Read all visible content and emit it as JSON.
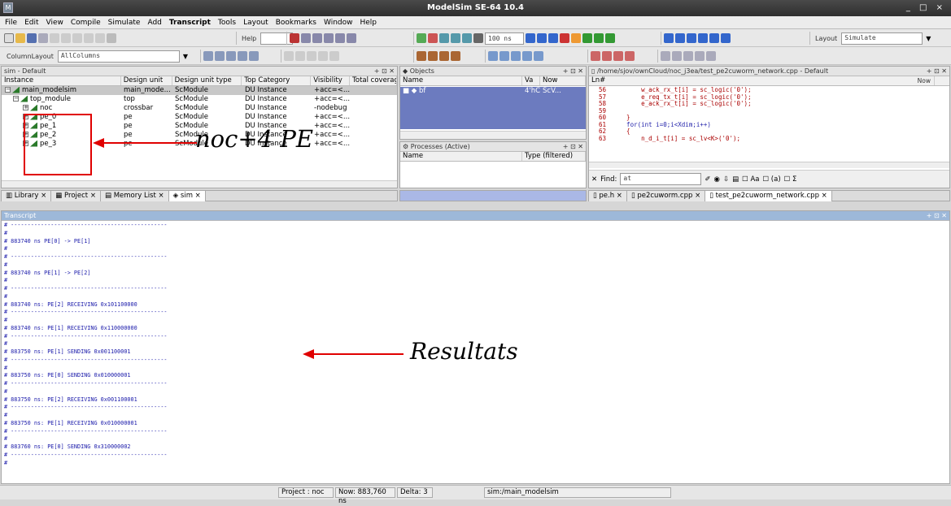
{
  "window": {
    "title": "ModelSim SE-64 10.4",
    "app_icon": "modelsim-icon",
    "controls": "_ □ ×"
  },
  "menu": [
    "File",
    "Edit",
    "View",
    "Compile",
    "Simulate",
    "Add",
    "Transcript",
    "Tools",
    "Layout",
    "Bookmarks",
    "Window",
    "Help"
  ],
  "toolbar": {
    "help_label": "Help",
    "time_value": "100 ns",
    "layout_label": "Layout",
    "layout_value": "Simulate",
    "column_layout_label": "ColumnLayout",
    "column_layout_value": "AllColumns"
  },
  "sim_panel": {
    "title": "sim - Default",
    "columns": [
      "Instance",
      "Design unit",
      "Design unit type",
      "Top Category",
      "Visibility",
      "Total coverag"
    ],
    "rows": [
      {
        "instance": "main_modelsim",
        "unit": "main_mode...",
        "type": "ScModule",
        "category": "DU Instance",
        "visibility": "+acc=<..."
      },
      {
        "instance": "top_module",
        "unit": "top",
        "type": "ScModule",
        "category": "DU Instance",
        "visibility": "+acc=<..."
      },
      {
        "instance": "noc",
        "unit": "crossbar",
        "type": "ScModule",
        "category": "DU Instance",
        "visibility": "-nodebug"
      },
      {
        "instance": "pe_0",
        "unit": "pe",
        "type": "ScModule",
        "category": "DU Instance",
        "visibility": "+acc=<..."
      },
      {
        "instance": "pe_1",
        "unit": "pe",
        "type": "ScModule",
        "category": "DU Instance",
        "visibility": "+acc=<..."
      },
      {
        "instance": "pe_2",
        "unit": "pe",
        "type": "ScModule",
        "category": "DU Instance",
        "visibility": "+acc=<..."
      },
      {
        "instance": "pe_3",
        "unit": "pe",
        "type": "ScModule",
        "category": "DU Instance",
        "visibility": "+acc=<..."
      }
    ],
    "tabs": [
      "Library",
      "Project",
      "Memory List",
      "sim"
    ]
  },
  "objects_panel": {
    "title": "Objects",
    "columns": [
      "Name",
      "Va",
      "Now"
    ],
    "rows": [
      {
        "name": "bf",
        "value": "4'hC",
        "extra": "ScV..."
      }
    ]
  },
  "processes_panel": {
    "title": "Processes (Active)",
    "columns": [
      "Name",
      "Type (filtered)"
    ]
  },
  "source_panel": {
    "title": "/home/sjov/ownCloud/noc_j3ea/test_pe2cuworm_network.cpp - Default",
    "ln_header": "Ln#",
    "now_label": "Now",
    "lines": [
      {
        "n": "56",
        "code": "        w_ack_rx_t[i] = sc_logic('0');"
      },
      {
        "n": "57",
        "code": "        e_req_tx_t[i] = sc_logic('0');"
      },
      {
        "n": "58",
        "code": "        e_ack_rx_t[i] = sc_logic('0');"
      },
      {
        "n": "59",
        "code": ""
      },
      {
        "n": "60",
        "code": "    }"
      },
      {
        "n": "61",
        "code": "    for(int i=0;i<Xdim;i++)"
      },
      {
        "n": "62",
        "code": "    {"
      },
      {
        "n": "63",
        "code": "        n_d_i_t[i] = sc_lv<K>('0');"
      }
    ],
    "find_label": "Find:",
    "find_value": "at",
    "find_opt_case": "Aa",
    "find_opt_word": "(a)",
    "find_opt_sum": "Σ",
    "tabs": [
      "pe.h",
      "pe2cuworm.cpp",
      "test_pe2cuworm_network.cpp"
    ]
  },
  "transcript": {
    "title": "Transcript",
    "lines": [
      "# -----------------------------------------------",
      "# ",
      "# 883740 ns PE[0] -> PE[1]",
      "# ",
      "# -----------------------------------------------",
      "# ",
      "# 883740 ns PE[1] -> PE[2]",
      "# ",
      "# -----------------------------------------------",
      "# ",
      "# 883740 ns: PE[2] RECEIVING 0x101100000",
      "# -----------------------------------------------",
      "# ",
      "# 883740 ns: PE[1] RECEIVING 0x110000000",
      "# -----------------------------------------------",
      "# ",
      "# 883750 ns: PE[1] SENDING 0x001100001",
      "# -----------------------------------------------",
      "# ",
      "# 883750 ns: PE[0] SENDING 0x010000001",
      "# -----------------------------------------------",
      "# ",
      "# 883750 ns: PE[2] RECEIVING 0x001100001",
      "# -----------------------------------------------",
      "# ",
      "# 883750 ns: PE[1] RECEIVING 0x010000001",
      "# -----------------------------------------------",
      "# ",
      "# 883760 ns: PE[0] SENDING 0x310000002",
      "# -----------------------------------------------",
      "# "
    ]
  },
  "status": {
    "project": "Project : noc",
    "now": "Now: 883,760 ns",
    "delta": "Delta: 3",
    "context": "sim:/main_modelsim"
  },
  "annotations": {
    "noc_label": "noc+4 PE",
    "result_label": "Resultats"
  },
  "colors": {
    "title_bg": "#2e2e2e",
    "transcript_header": "#9db8d9",
    "transcript_text": "#1a1aaa",
    "objects_selection": "#6c7bbf",
    "annotation_red": "#e00000"
  }
}
